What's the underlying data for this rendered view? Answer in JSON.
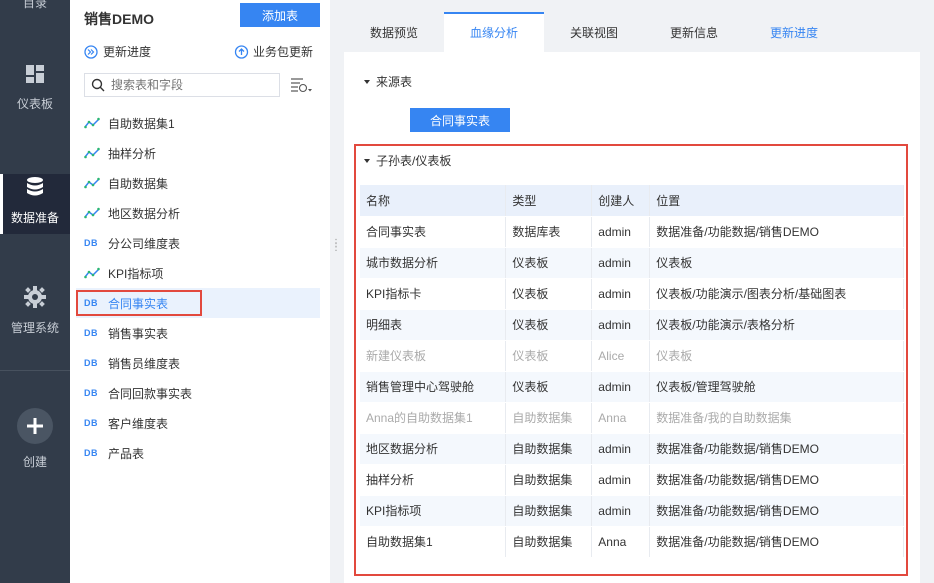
{
  "nav": {
    "top_label": "目录",
    "items": [
      {
        "label": "仪表板",
        "icon": "dashboard-icon"
      },
      {
        "label": "数据准备",
        "icon": "database-icon",
        "active": true
      },
      {
        "label": "管理系统",
        "icon": "gear-icon"
      },
      {
        "label": "创建",
        "icon": "plus-circle-icon"
      }
    ]
  },
  "panel": {
    "title": "销售DEMO",
    "add_button": "添加表",
    "update_progress": "更新进度",
    "package_update": "业务包更新",
    "search_placeholder": "搜索表和字段",
    "items": [
      {
        "label": "自助数据集1",
        "type": "etl"
      },
      {
        "label": "抽样分析",
        "type": "etl"
      },
      {
        "label": "自助数据集",
        "type": "etl"
      },
      {
        "label": "地区数据分析",
        "type": "etl"
      },
      {
        "label": "分公司维度表",
        "type": "db"
      },
      {
        "label": "KPI指标项",
        "type": "etl"
      },
      {
        "label": "合同事实表",
        "type": "db",
        "selected": true
      },
      {
        "label": "销售事实表",
        "type": "db"
      },
      {
        "label": "销售员维度表",
        "type": "db"
      },
      {
        "label": "合同回款事实表",
        "type": "db"
      },
      {
        "label": "客户维度表",
        "type": "db"
      },
      {
        "label": "产品表",
        "type": "db"
      }
    ],
    "db_tag": "DB"
  },
  "tabs": [
    {
      "label": "数据预览"
    },
    {
      "label": "血缘分析",
      "active": true
    },
    {
      "label": "关联视图"
    },
    {
      "label": "更新信息"
    },
    {
      "label": "更新进度",
      "link": true
    }
  ],
  "lineage": {
    "source_heading": "来源表",
    "source_table": "合同事实表",
    "children_heading": "子孙表/仪表板",
    "columns": [
      "名称",
      "类型",
      "创建人",
      "位置"
    ],
    "rows": [
      [
        "合同事实表",
        "数据库表",
        "admin",
        "数据准备/功能数据/销售DEMO"
      ],
      [
        "城市数据分析",
        "仪表板",
        "admin",
        "仪表板"
      ],
      [
        "KPI指标卡",
        "仪表板",
        "admin",
        "仪表板/功能演示/图表分析/基础图表"
      ],
      [
        "明细表",
        "仪表板",
        "admin",
        "仪表板/功能演示/表格分析"
      ],
      [
        "新建仪表板",
        "仪表板",
        "Alice",
        "仪表板"
      ],
      [
        "销售管理中心驾驶舱",
        "仪表板",
        "admin",
        "仪表板/管理驾驶舱"
      ],
      [
        "Anna的自助数据集1",
        "自助数据集",
        "Anna",
        "数据准备/我的自助数据集"
      ],
      [
        "地区数据分析",
        "自助数据集",
        "admin",
        "数据准备/功能数据/销售DEMO"
      ],
      [
        "抽样分析",
        "自助数据集",
        "admin",
        "数据准备/功能数据/销售DEMO"
      ],
      [
        "KPI指标项",
        "自助数据集",
        "admin",
        "数据准备/功能数据/销售DEMO"
      ],
      [
        "自助数据集1",
        "自助数据集",
        "Anna",
        "数据准备/功能数据/销售DEMO"
      ]
    ],
    "muted_rows": [
      4,
      6
    ]
  },
  "colors": {
    "accent": "#3685f2",
    "nav_bg": "#323c4a",
    "highlight": "#e2493e"
  }
}
